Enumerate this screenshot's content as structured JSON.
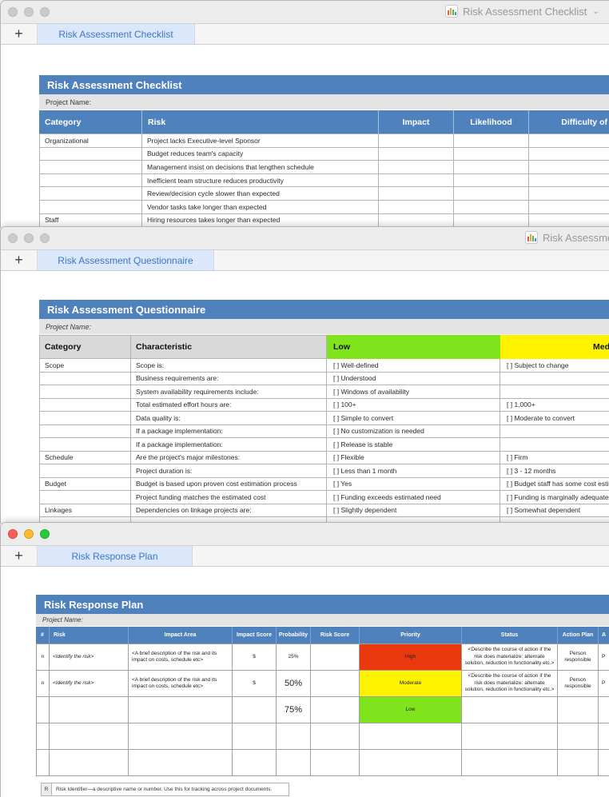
{
  "chrome": {
    "add_tab": "+"
  },
  "colors": {
    "header_blue": "#4f81bd",
    "low_green": "#7fe41b",
    "medium_yellow": "#fff200",
    "high_red": "#ea380f"
  },
  "w1": {
    "window_title": "Risk Assessment Checklist",
    "tab": "Risk Assessment Checklist",
    "table_title": "Risk Assessment Checklist",
    "project_label": "Project Name:",
    "headers": [
      "Category",
      "Risk",
      "Impact",
      "Likelihood",
      "Difficulty of Detection"
    ],
    "rows": [
      [
        "Organizational",
        "Project lacks Executive-level Sponsor"
      ],
      [
        "",
        "Budget reduces team's capacity"
      ],
      [
        "",
        "Management insist on decisions that lengthen schedule"
      ],
      [
        "",
        "Inefficient team structure reduces productivity"
      ],
      [
        "",
        "Review/decision cycle slower than expected"
      ],
      [
        "",
        "Vendor tasks take longer than expected"
      ],
      [
        "Staff",
        "Hiring resources takes longer than expected"
      ]
    ]
  },
  "w2": {
    "window_title": "Risk Assessment Questionnaire",
    "tab": "Risk Assessment Questionnaire",
    "table_title": "Risk Assessment Questionnaire",
    "project_label": "Project Name:",
    "headers": [
      "Category",
      "Characteristic",
      "Low",
      "Medium"
    ],
    "rows": [
      [
        "Scope",
        "Scope is:",
        "[ ] Well-defined",
        "[ ] Subject to change"
      ],
      [
        "",
        "Business requirements are:",
        "[ ] Understood",
        ""
      ],
      [
        "",
        "System availability requirements include:",
        "[ ] Windows of availability",
        ""
      ],
      [
        "",
        "Total estimated effort hours are:",
        "[ ] 100+",
        "[ ] 1,000+"
      ],
      [
        "",
        "Data quality is:",
        "[ ] Simple to convert",
        "[ ] Moderate  to convert"
      ],
      [
        "",
        "If a package implementation:",
        "[ ] No customization is needed",
        ""
      ],
      [
        "",
        "If a package implementation:",
        "[ ] Release is stable",
        ""
      ],
      [
        "Schedule",
        "Are the project's major milestones:",
        "[ ] Flexible",
        "[ ] Firm"
      ],
      [
        "",
        "Project duration is:",
        "[ ] Less than 1 month",
        "[ ] 3 - 12 months"
      ],
      [
        "Budget",
        "Budget is based upon proven cost estimation process",
        "[ ] Yes",
        "[ ] Budget staff has some cost estimation experience"
      ],
      [
        "",
        "Project funding matches the estimated cost",
        "[ ] Funding exceeds estimated need",
        "[ ] Funding is marginally adequate"
      ],
      [
        "Linkages",
        "Dependencies on linkage projects are:",
        "[ ] Slightly dependent",
        "[ ] Somewhat dependent"
      ]
    ]
  },
  "w3": {
    "tab": "Risk Response Plan",
    "table_title": "Risk Response Plan",
    "project_label": "Project Name:",
    "headers": [
      "#",
      "Risk",
      "Impact Area",
      "Impact Score",
      "Probability",
      "Risk Score",
      "Priority",
      "Status",
      "Action Plan",
      "A"
    ],
    "rows": [
      [
        "n",
        "<Identify the risk>",
        "<A brief description of the risk and its impact on costs, schedule etc>",
        "$",
        "25%",
        "",
        "High",
        "<Describe the course of action if the risk does materialize: alternate solution, reduction in functionality etc.>",
        "Person responsible",
        "P"
      ],
      [
        "n",
        "<Identify the risk>",
        "<A brief description of the risk and its impact on costs, schedule etc>",
        "$",
        "50%",
        "",
        "Moderate",
        "<Describe the course of action if the risk does materialize: alternate solution, reduction in functionality etc.>",
        "Person responsible",
        "P"
      ],
      [
        "",
        "",
        "",
        "",
        "75%",
        "",
        "Low",
        "",
        "",
        ""
      ],
      [
        "",
        "",
        "",
        "",
        "",
        "",
        "",
        "",
        "",
        ""
      ],
      [
        "",
        "",
        "",
        "",
        "",
        "",
        "",
        "",
        "",
        ""
      ]
    ],
    "footnote_key": "R",
    "footnote": "Risk Identifier—a descriptive name or number. Use this for tracking across project documents."
  }
}
